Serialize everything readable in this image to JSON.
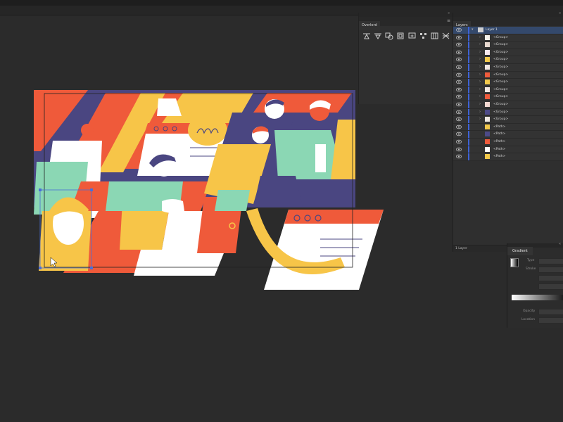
{
  "overlord_panel": {
    "tab_label": "Overlord",
    "tools": [
      {
        "icon": "align-top-icon"
      },
      {
        "icon": "align-bottom-icon"
      },
      {
        "icon": "settings-gear-icon"
      },
      {
        "icon": "layer-stack-icon"
      },
      {
        "icon": "artboard-icon"
      },
      {
        "icon": "nodes-icon"
      },
      {
        "icon": "grid-icon"
      },
      {
        "icon": "x-cross-icon"
      }
    ]
  },
  "layers_panel": {
    "tab_label": "Layers",
    "rows": [
      {
        "label": "Layer 1",
        "selected": true,
        "thumb": "#cfcfcf"
      },
      {
        "label": "<Group>",
        "thumb": "#f4f0e9"
      },
      {
        "label": "<Group>",
        "thumb": "#e8d9d0"
      },
      {
        "label": "<Group>",
        "thumb": "#f7e9ef"
      },
      {
        "label": "<Group>",
        "thumb": "#f2c84b"
      },
      {
        "label": "<Group>",
        "thumb": "#f1e7e4"
      },
      {
        "label": "<Group>",
        "thumb": "#ef5b3c"
      },
      {
        "label": "<Group>",
        "thumb": "#f2c84b"
      },
      {
        "label": "<Group>",
        "thumb": "#f4e8e3"
      },
      {
        "label": "<Group>",
        "thumb": "#ef5b3c"
      },
      {
        "label": "<Group>",
        "thumb": "#f3d8d1"
      },
      {
        "label": "<Group>",
        "thumb": "#4d4a88"
      },
      {
        "label": "<Group>",
        "thumb": "#efe9e2"
      },
      {
        "label": "<Path>",
        "thumb": "#f2c84b"
      },
      {
        "label": "<Path>",
        "thumb": "#4d4a88"
      },
      {
        "label": "<Path>",
        "thumb": "#ef5b3c"
      },
      {
        "label": "<Path>",
        "thumb": "#ffffff"
      },
      {
        "label": "<Path>",
        "thumb": "#f2c84b"
      }
    ],
    "footer": "1 Layer"
  },
  "gradient_panel": {
    "tab_label": "Gradient",
    "type_label": "Type",
    "stroke_label": "Stroke",
    "opacity_label": "Opacity",
    "location_label": "Location"
  },
  "colors": {
    "purple": "#4a4681",
    "red": "#ef5a3a",
    "yellow": "#f7c548",
    "mint": "#8bd7b4",
    "white": "#ffffff",
    "selection": "#3e63d8"
  }
}
